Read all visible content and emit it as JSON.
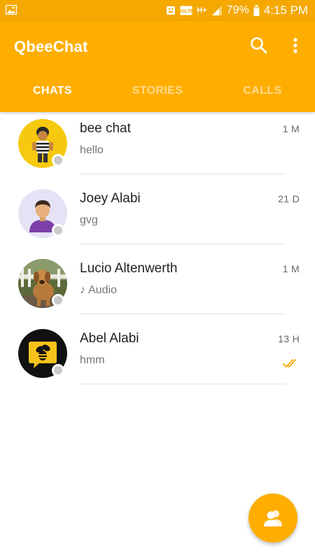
{
  "status_bar": {
    "battery": "79%",
    "time": "4:15 PM",
    "network": "H+",
    "icons": [
      "image-notification-icon",
      "usb-debug-icon",
      "volte-icon",
      "network-h-plus-icon",
      "signal-icon",
      "battery-icon"
    ]
  },
  "app_bar": {
    "title": "QbeeChat",
    "background": "#FFAE00",
    "icons": [
      "search-icon",
      "more-vert-icon"
    ]
  },
  "tabs": [
    {
      "label": "CHATS",
      "active": true
    },
    {
      "label": "STORIES",
      "active": false
    },
    {
      "label": "CALLS",
      "active": false
    }
  ],
  "chats": [
    {
      "name": "bee chat",
      "preview": "hello",
      "time": "1 M",
      "avatar": "cartoon-character-avatar"
    },
    {
      "name": "Joey Alabi",
      "preview": "gvg",
      "time": "21 D",
      "avatar": "default-person-avatar"
    },
    {
      "name": "Lucio Altenwerth",
      "preview": "Audio",
      "preview_icon": "music-note-icon",
      "time": "1 M",
      "avatar": "dog-photo-avatar"
    },
    {
      "name": "Abel Alabi",
      "preview": "hmm",
      "time": "13 H",
      "avatar": "qbee-logo-avatar",
      "status_icon": "double-check-icon"
    }
  ],
  "fab": {
    "icon": "contacts-icon"
  }
}
